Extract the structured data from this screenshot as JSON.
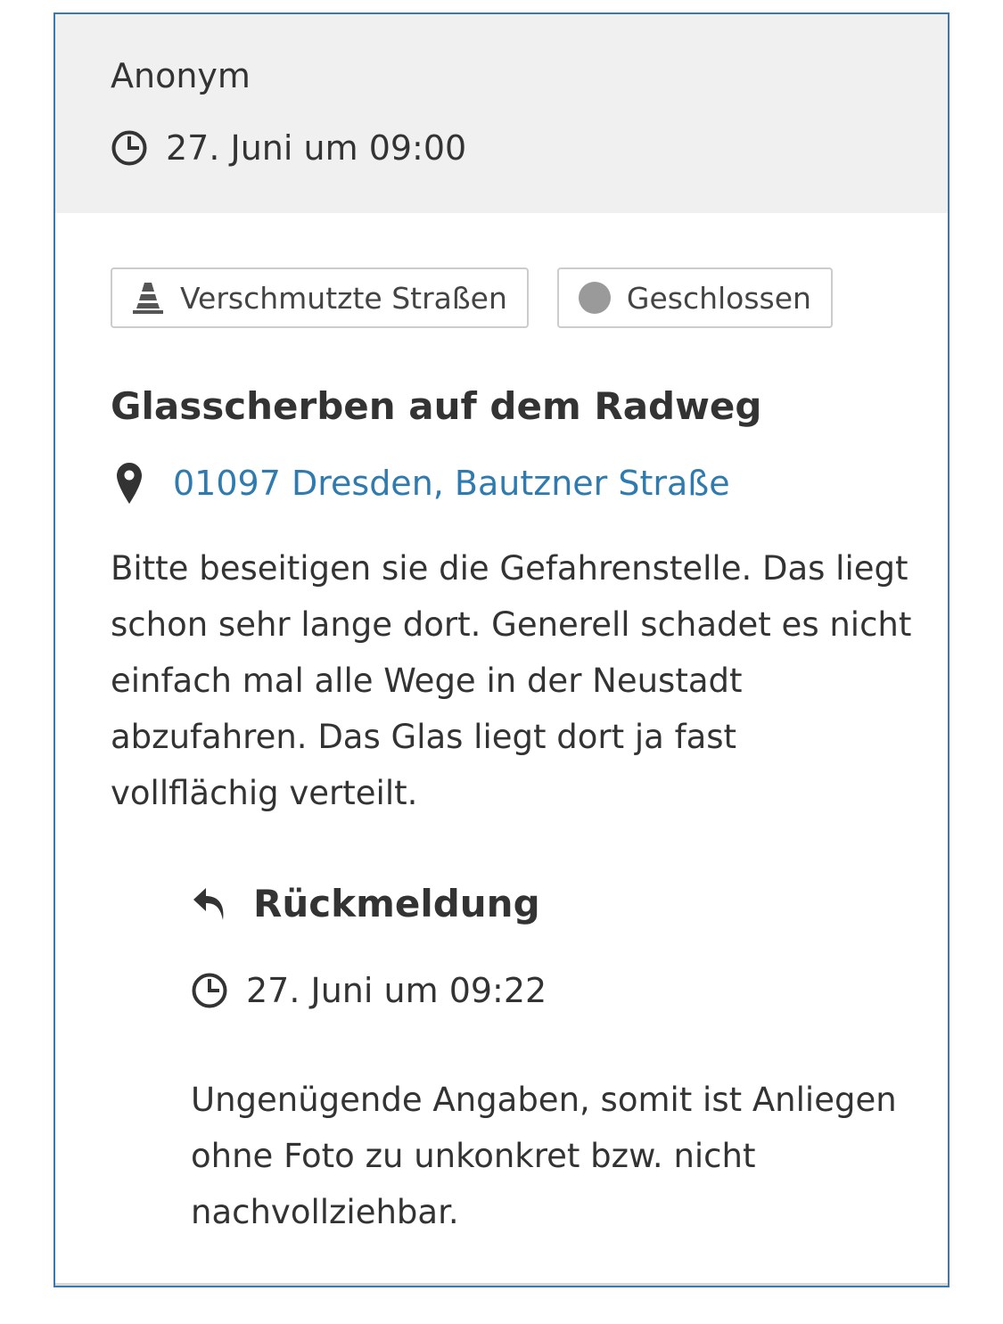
{
  "post": {
    "author": "Anonym",
    "timestamp": "27. Juni um 09:00",
    "tags": {
      "category": {
        "label": "Verschmutzte Straßen",
        "icon": "traffic-cone-icon"
      },
      "status": {
        "label": "Geschlossen",
        "icon": "status-dot-icon",
        "color": "#9a9a9a"
      }
    },
    "title": "Glasscherben auf dem Radweg",
    "location": {
      "text": "01097 Dresden, Bautzner Straße",
      "icon": "map-pin-icon",
      "color": "#2f7bb0"
    },
    "description": "Bitte beseitigen sie die Gefahrenstelle. Das liegt schon sehr lange dort. Generell schadet es nicht einfach mal alle Wege in der Neu­stadt abzufahren. Das Glas liegt dort ja fast vollflächig verteilt."
  },
  "response": {
    "heading": "Rückmeldung",
    "icon": "reply-icon",
    "timestamp": "27. Juni um 09:22",
    "text": "Ungenügende Angaben, somit ist Anliegen ohne Foto zu unkonkret bzw. nicht nachvollziehbar."
  },
  "colors": {
    "card_border": "#3d78a8",
    "header_background": "#f0f0f0",
    "link": "#2f7bb0"
  }
}
